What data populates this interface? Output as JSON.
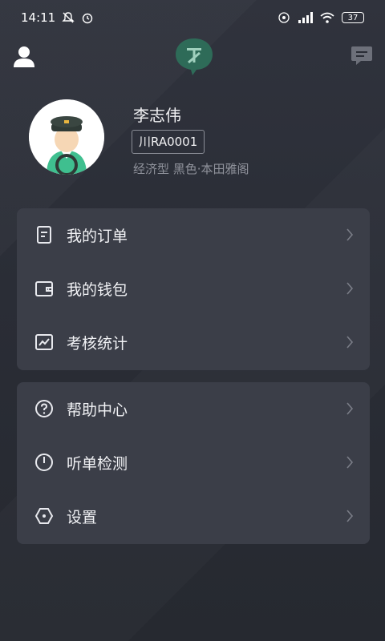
{
  "statusbar": {
    "time": "14:11",
    "battery": "37"
  },
  "profile": {
    "name": "李志伟",
    "plate": "川RA0001",
    "car_info": "经济型  黑色·本田雅阁"
  },
  "menu_group_1": [
    {
      "label": "我的订单",
      "icon": "order-icon"
    },
    {
      "label": "我的钱包",
      "icon": "wallet-icon"
    },
    {
      "label": "考核统计",
      "icon": "chart-icon"
    }
  ],
  "menu_group_2": [
    {
      "label": "帮助中心",
      "icon": "help-icon"
    },
    {
      "label": "听单检测",
      "icon": "timer-icon"
    },
    {
      "label": "设置",
      "icon": "settings-icon"
    }
  ],
  "colors": {
    "background": "#2a2d36",
    "card": "#3b3e48",
    "logo": "#2e6b58"
  }
}
